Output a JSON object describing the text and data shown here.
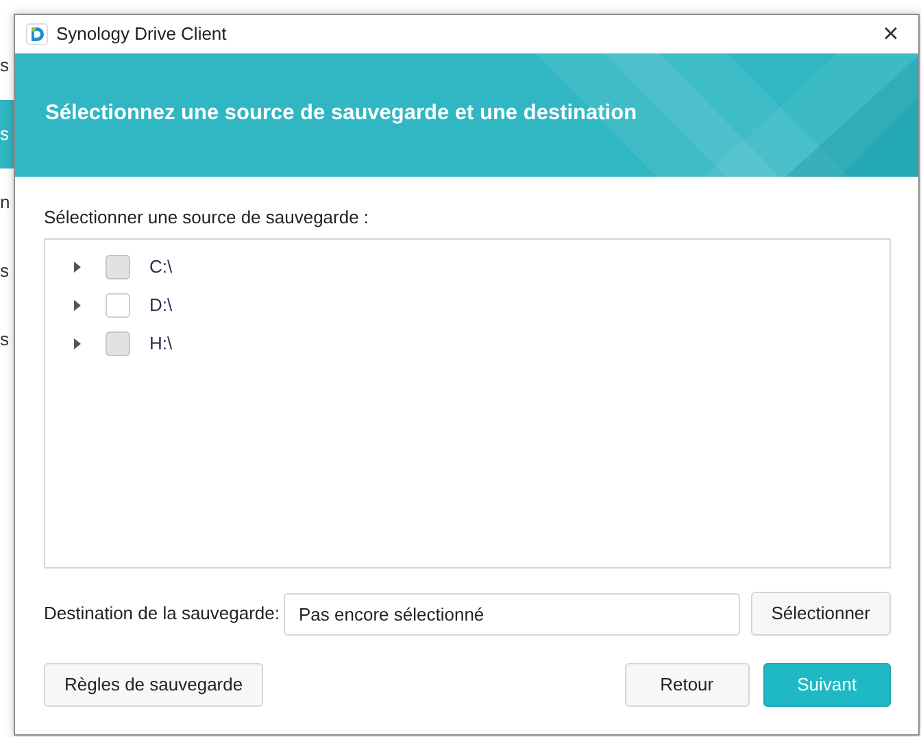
{
  "background_window": {
    "items": [
      {
        "text": "s",
        "selected": false
      },
      {
        "text": "s",
        "selected": true
      },
      {
        "text": "n",
        "selected": false
      },
      {
        "text": "s",
        "selected": false
      },
      {
        "text": "s",
        "selected": false
      }
    ]
  },
  "window": {
    "title": "Synology Drive Client",
    "close": "×"
  },
  "header": {
    "title": "Sélectionnez une source de sauvegarde et une destination"
  },
  "source": {
    "label": "Sélectionner une source de sauvegarde :",
    "drives": [
      {
        "label": "C:\\",
        "expanded": false,
        "disabled": true
      },
      {
        "label": "D:\\",
        "expanded": false,
        "disabled": false
      },
      {
        "label": "H:\\",
        "expanded": false,
        "disabled": true
      }
    ]
  },
  "destination": {
    "label": "Destination de la sauvegarde:",
    "value": "Pas encore sélectionné",
    "button": "Sélectionner"
  },
  "buttons": {
    "rules": "Règles de sauvegarde",
    "back": "Retour",
    "next": "Suivant"
  }
}
